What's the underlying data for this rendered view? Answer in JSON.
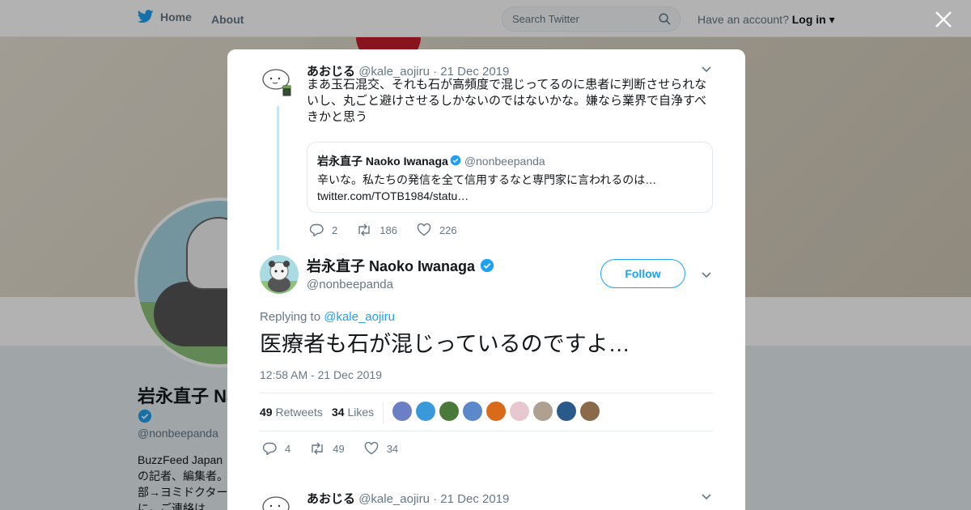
{
  "topbar": {
    "home_label": "Home",
    "about_label": "About",
    "search_placeholder": "Search Twitter",
    "have_account": "Have an account?",
    "login_label": "Log in"
  },
  "profile": {
    "name": "岩永直子 Na",
    "handle": "@nonbeepanda",
    "bio": "BuzzFeed Japan\nの記者、編集者。\n部→ヨミドクター\nに。ご連絡は"
  },
  "tweet1": {
    "name": "あおじる",
    "handle": "@kale_aojiru",
    "date": "· 21 Dec 2019",
    "text": "まあ玉石混交、それも石が高頻度で混じってるのに患者に判断させられないし、丸ごと避けさせるしかないのではないかな。嫌なら業界で自浄すべきかと思う",
    "quote": {
      "name": "岩永直子 Naoko Iwanaga",
      "handle": "@nonbeepanda",
      "text": "辛いな。私たちの発信を全て信用するなと専門家に言われるのは… twitter.com/TOTB1984/statu…"
    },
    "replies": "2",
    "retweets": "186",
    "likes": "226"
  },
  "main_tweet": {
    "name": "岩永直子 Naoko Iwanaga",
    "handle": "@nonbeepanda",
    "follow_label": "Follow",
    "replying_prefix": "Replying to",
    "replying_to": "@kale_aojiru",
    "text": "医療者も石が混じっているのですよ…",
    "timestamp": "12:58 AM - 21 Dec 2019",
    "retweets_count": "49",
    "retweets_label": "Retweets",
    "likes_count": "34",
    "likes_label": "Likes",
    "likers": [
      "#6b7fc4",
      "#3a9ad9",
      "#4a7a3a",
      "#5a88c8",
      "#d96a1a",
      "#e8c8d0",
      "#b0a090",
      "#2a5a8a",
      "#8a6a4a"
    ],
    "replies": "4",
    "retweets": "49",
    "likes": "34"
  },
  "tweet3": {
    "name": "あおじる",
    "handle": "@kale_aojiru",
    "date": "· 21 Dec 2019"
  },
  "colors": {
    "accent": "#1da1f2",
    "verified": "#1da1f2",
    "muted": "#657786"
  }
}
